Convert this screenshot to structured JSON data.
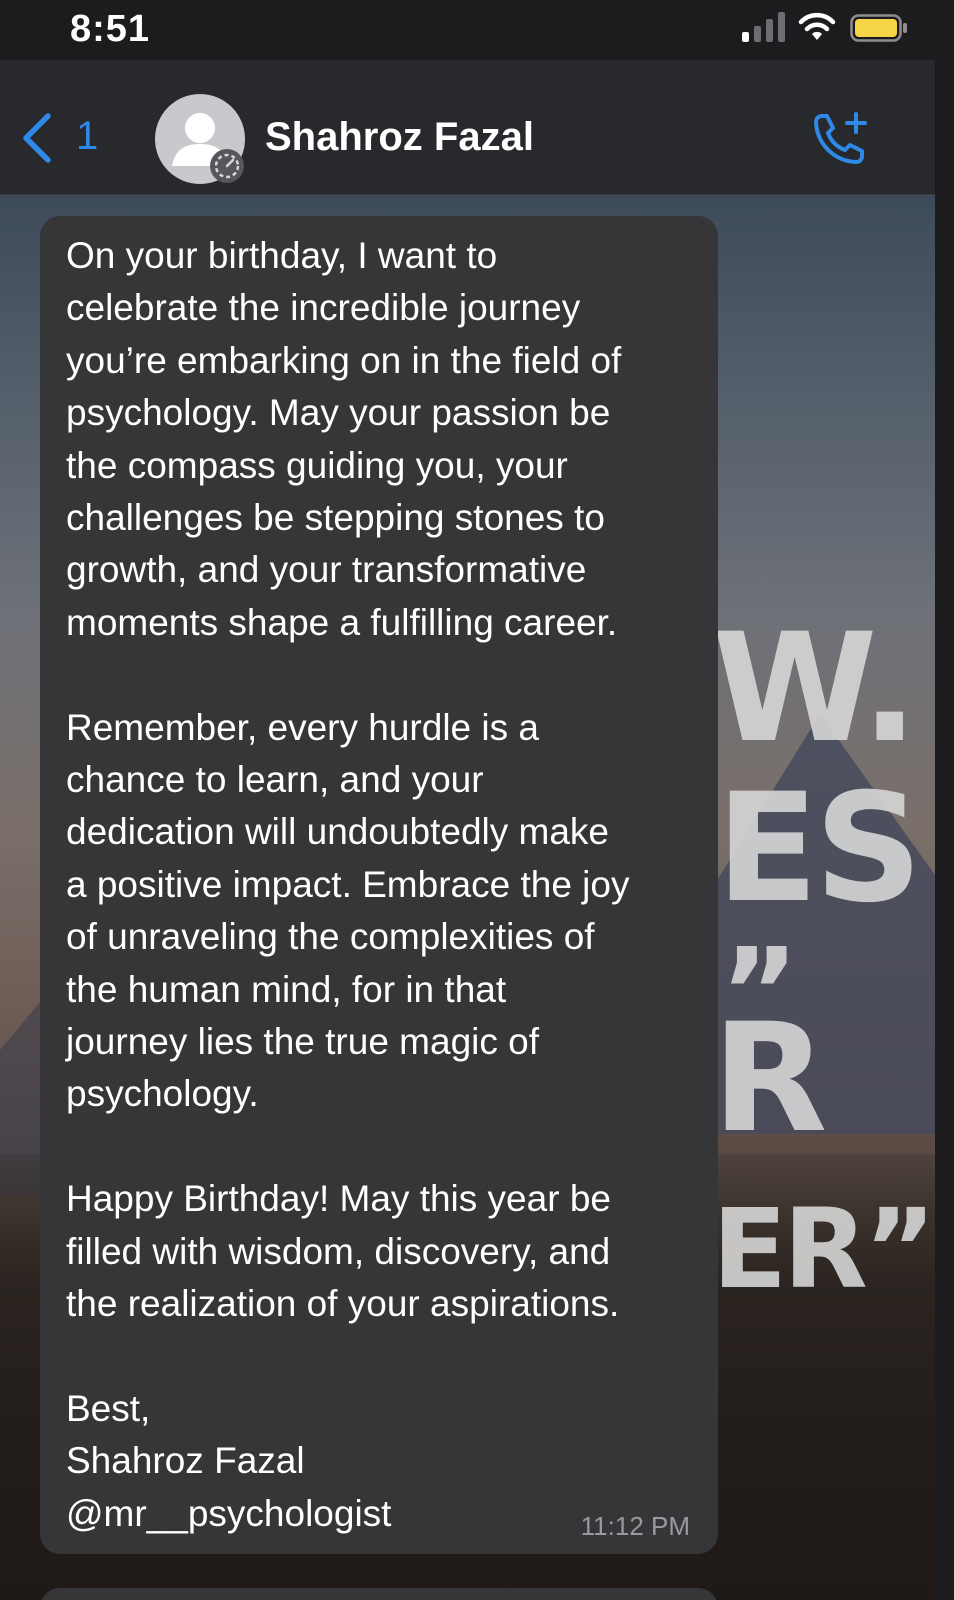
{
  "status_bar": {
    "time": "8:51",
    "signal_icon": "cellular-signal-icon",
    "wifi_icon": "wifi-icon",
    "battery_icon": "battery-icon",
    "battery_color": "#f5d547"
  },
  "header": {
    "back_icon": "chevron-left-icon",
    "back_count": "1",
    "contact_name": "Shahroz Fazal",
    "avatar_icon": "avatar-icon",
    "call_icon": "add-call-icon",
    "accent_color": "#2e8ae6"
  },
  "wallpaper": {
    "visible_text": [
      "W.",
      "ES",
      "”",
      "R",
      "ER”."
    ]
  },
  "message": {
    "paragraphs": [
      "On your birthday, I want to\ncelebrate the incredible journey\nyou’re embarking on in the field of\npsychology. May your passion be\nthe compass guiding you, your\nchallenges be stepping stones to\ngrowth, and your transformative\nmoments shape a fulfilling career.",
      "Remember, every hurdle is a\nchance to learn, and your\ndedication will undoubtedly make\na positive impact. Embrace the joy\nof unraveling the complexities of\nthe human mind, for in that\njourney lies the true magic of\npsychology.",
      "Happy Birthday! May this year be\nfilled with wisdom, discovery, and\nthe realization of your aspirations.",
      "Best,\nShahroz Fazal\n@mr__psychologist"
    ],
    "timestamp": "11:12 PM",
    "bubble_color": "#363638"
  }
}
